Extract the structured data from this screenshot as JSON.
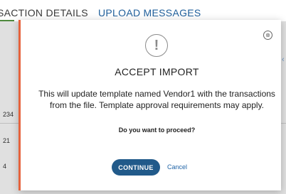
{
  "background": {
    "tabs": [
      {
        "label": "SACTION DETAILS",
        "active": true
      },
      {
        "label": "UPLOAD MESSAGES",
        "active": false
      }
    ],
    "row_values": [
      "234",
      "21",
      "4"
    ],
    "chevron": "‹"
  },
  "modal": {
    "close_symbol": "⊗",
    "alert_symbol": "!",
    "title": "ACCEPT IMPORT",
    "body_line1": "This will update template named Vendor1 with the transactions",
    "body_line2": "from the file. Template approval requirements may apply.",
    "question": "Do you want to proceed?",
    "continue_label": "CONTINUE",
    "cancel_label": "Cancel"
  },
  "colors": {
    "accent_bar": "#e6623c",
    "primary_button": "#215a8a",
    "link": "#1f63a6",
    "tab_active_underline": "#4f8a3e"
  }
}
